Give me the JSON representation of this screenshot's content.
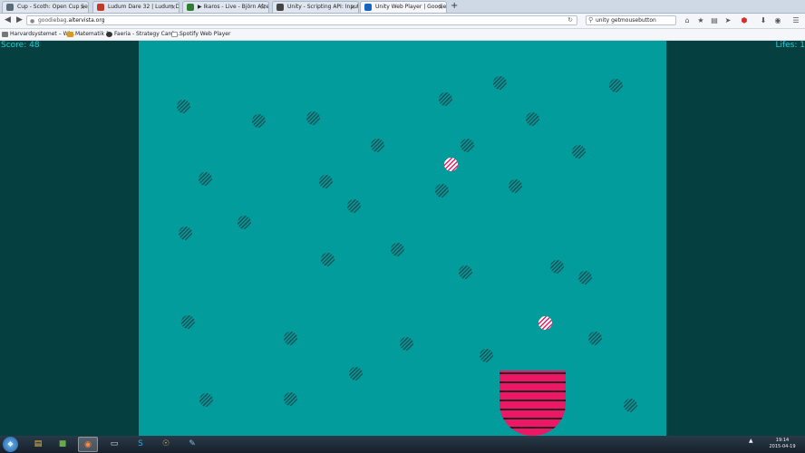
{
  "browser": {
    "tabs": [
      {
        "label": "Cup - Scoth: Open Cup Ser...",
        "fav": "#5b6b7a",
        "active": false
      },
      {
        "label": "Ludum Dare 32 | Ludum D...",
        "fav": "#c0392b",
        "active": false
      },
      {
        "label": "▶ Ikaros - Live - Björn Afze...",
        "fav": "#2e7d32",
        "active": false
      },
      {
        "label": "Unity - Scripting API: Input...",
        "fav": "#444444",
        "active": false
      },
      {
        "label": "Unity Web Player | Goodie ...",
        "fav": "#1565c0",
        "active": true
      }
    ],
    "new_tab": "+",
    "url_prefix": "goodiebag.",
    "url_domain": "altervista.org",
    "search_value": "unity getmousebutton",
    "bookmarks": [
      {
        "label": "Harvardsystemet – Wi...",
        "color": "#777777"
      },
      {
        "label": "Matematik 1",
        "color": "#d79b29"
      },
      {
        "label": "Faeria - Strategy Card ...",
        "color": "#333333"
      },
      {
        "label": "Spotify Web Player",
        "color": "#ffffff"
      }
    ],
    "toolbar_icons": [
      "home-icon",
      "bookmark-star-icon",
      "clipboard-icon",
      "send-icon",
      "adblock-icon",
      "download-icon",
      "chat-icon",
      "menu-icon"
    ]
  },
  "game": {
    "score_label": "Score: 48",
    "lives_label": "Lifes: 1",
    "colors": {
      "side": "#063f40",
      "field": "#039c9c",
      "hud": "#18d4d6",
      "cup": "#ee1766",
      "cup_stripe": "#2a1a24"
    }
  },
  "taskbar": {
    "apps": [
      "file-explorer-icon",
      "minecraft-icon",
      "firefox-icon",
      "terminal-icon",
      "skype-icon",
      "unity-icon",
      "paint-icon"
    ],
    "time": "19:14",
    "date": "2015-04-19"
  }
}
